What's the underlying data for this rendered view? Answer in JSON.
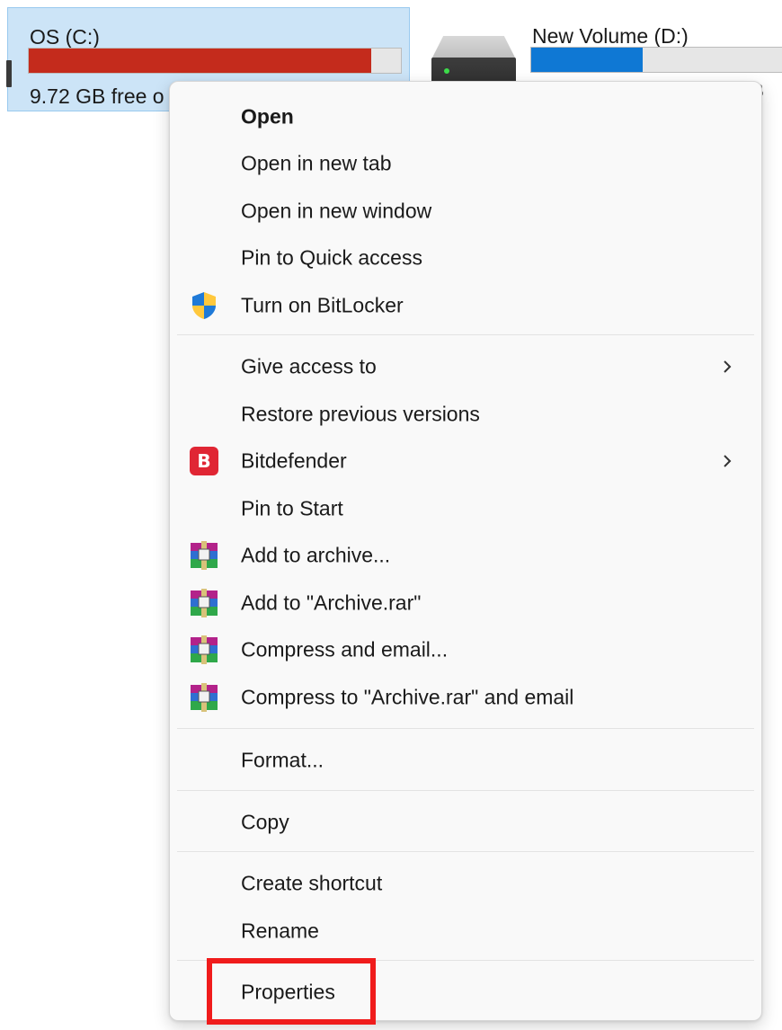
{
  "drives": {
    "c": {
      "label": "OS (C:)",
      "free_text": "9.72 GB free o",
      "usage_fraction": 0.92,
      "bar_color": "#c42b1c",
      "selected": true
    },
    "d": {
      "label": "New Volume (D:)",
      "usage_fraction": 0.43,
      "bar_color": "#0f78d4",
      "peek_text": "B"
    }
  },
  "context_menu": {
    "items": [
      {
        "label": "Open",
        "bold": true,
        "icon": null,
        "submenu": false
      },
      {
        "label": "Open in new tab",
        "icon": null,
        "submenu": false
      },
      {
        "label": "Open in new window",
        "icon": null,
        "submenu": false
      },
      {
        "label": "Pin to Quick access",
        "icon": null,
        "submenu": false
      },
      {
        "label": "Turn on BitLocker",
        "icon": "uac-shield-icon",
        "submenu": false
      },
      {
        "label": "Give access to",
        "icon": null,
        "submenu": true
      },
      {
        "label": "Restore previous versions",
        "icon": null,
        "submenu": false
      },
      {
        "label": "Bitdefender",
        "icon": "bitdefender-icon",
        "icon_text": "B",
        "submenu": true
      },
      {
        "label": "Pin to Start",
        "icon": null,
        "submenu": false
      },
      {
        "label": "Add to archive...",
        "icon": "winrar-icon",
        "submenu": false
      },
      {
        "label": "Add to \"Archive.rar\"",
        "icon": "winrar-icon",
        "submenu": false
      },
      {
        "label": "Compress and email...",
        "icon": "winrar-icon",
        "submenu": false
      },
      {
        "label": "Compress to \"Archive.rar\" and email",
        "icon": "winrar-icon",
        "submenu": false
      },
      {
        "label": "Format...",
        "icon": null,
        "submenu": false
      },
      {
        "label": "Copy",
        "icon": null,
        "submenu": false
      },
      {
        "label": "Create shortcut",
        "icon": null,
        "submenu": false
      },
      {
        "label": "Rename",
        "icon": null,
        "submenu": false
      },
      {
        "label": "Properties",
        "icon": null,
        "submenu": false,
        "highlighted": true
      }
    ]
  },
  "colors": {
    "highlight_border": "#f01c1c",
    "selection_bg": "#cce4f7",
    "menu_bg": "#f9f9f9"
  }
}
